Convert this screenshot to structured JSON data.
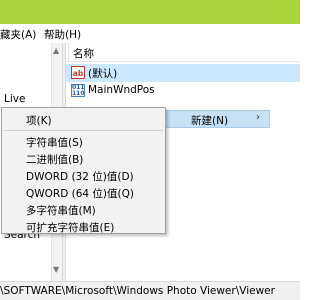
{
  "menu": {
    "favorites": "藏夹(A)",
    "help": "帮助(H)"
  },
  "tree": {
    "live_label": "Live",
    "search_label": "Search"
  },
  "list": {
    "header_name": "名称",
    "rows": [
      {
        "icon": "string-value-icon",
        "icon_text": "ab",
        "name": "(默认)"
      },
      {
        "icon": "binary-value-icon",
        "icon_text": "011 110",
        "name": "MainWndPos"
      }
    ]
  },
  "parent_menu": {
    "label": "新建(N)",
    "chevron": "›"
  },
  "context_menu": {
    "items": [
      "项(K)",
      "字符串值(S)",
      "二进制值(B)",
      "DWORD (32 位)值(D)",
      "QWORD (64 位)值(Q)",
      "多字符串值(M)",
      "可扩充字符串值(E)"
    ]
  },
  "status_bar": {
    "path": "\\SOFTWARE\\Microsoft\\Windows Photo Viewer\\Viewer"
  },
  "colors": {
    "title_bar": "#a9d63a",
    "selection": "#cce8ff",
    "menu_bg": "#f2f2f2"
  }
}
